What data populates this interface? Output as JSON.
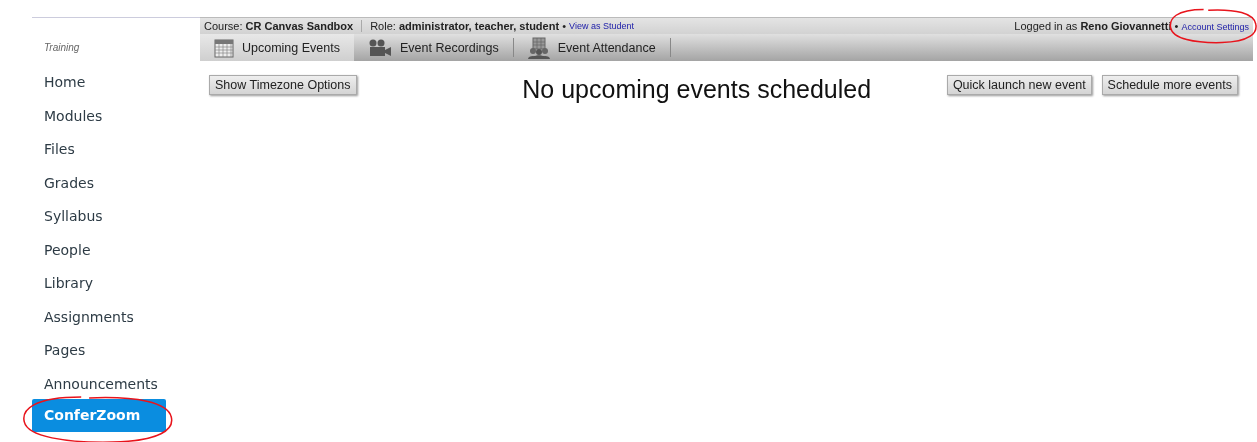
{
  "context_bar": {
    "course_label": "Course:",
    "course": "CR Canvas Sandbox",
    "role_label": "Role:",
    "roles": "administrator, teacher, student",
    "separator": "•",
    "view_as_link": "View as Student",
    "logged_in_label": "Logged in as",
    "user": "Reno Giovannetti",
    "account_link": {
      "label": "Account Settings",
      "circled": true
    }
  },
  "tabs": [
    {
      "label": "Upcoming Events",
      "selected": true
    },
    {
      "label": "Event Recordings",
      "selected": false
    },
    {
      "label": "Event Attendance",
      "selected": false
    }
  ],
  "sidebar": {
    "section_label": "Training",
    "items": [
      {
        "label": "Home",
        "selected": false,
        "circled": false
      },
      {
        "label": "Modules",
        "selected": false,
        "circled": false
      },
      {
        "label": "Files",
        "selected": false,
        "circled": false
      },
      {
        "label": "Grades",
        "selected": false,
        "circled": false
      },
      {
        "label": "Syllabus",
        "selected": false,
        "circled": false
      },
      {
        "label": "People",
        "selected": false,
        "circled": false
      },
      {
        "label": "Library",
        "selected": false,
        "circled": false
      },
      {
        "label": "Assignments",
        "selected": false,
        "circled": false
      },
      {
        "label": "Pages",
        "selected": false,
        "circled": false
      },
      {
        "label": "Announcements",
        "selected": false,
        "circled": false
      },
      {
        "label": "ConferZoom",
        "selected": true,
        "circled": true
      }
    ]
  },
  "toolbar": {
    "timezone_button": "Show Timezone Options",
    "heading": "No upcoming events scheduled",
    "buttons": [
      "Quick launch new event",
      "Schedule more events"
    ]
  }
}
